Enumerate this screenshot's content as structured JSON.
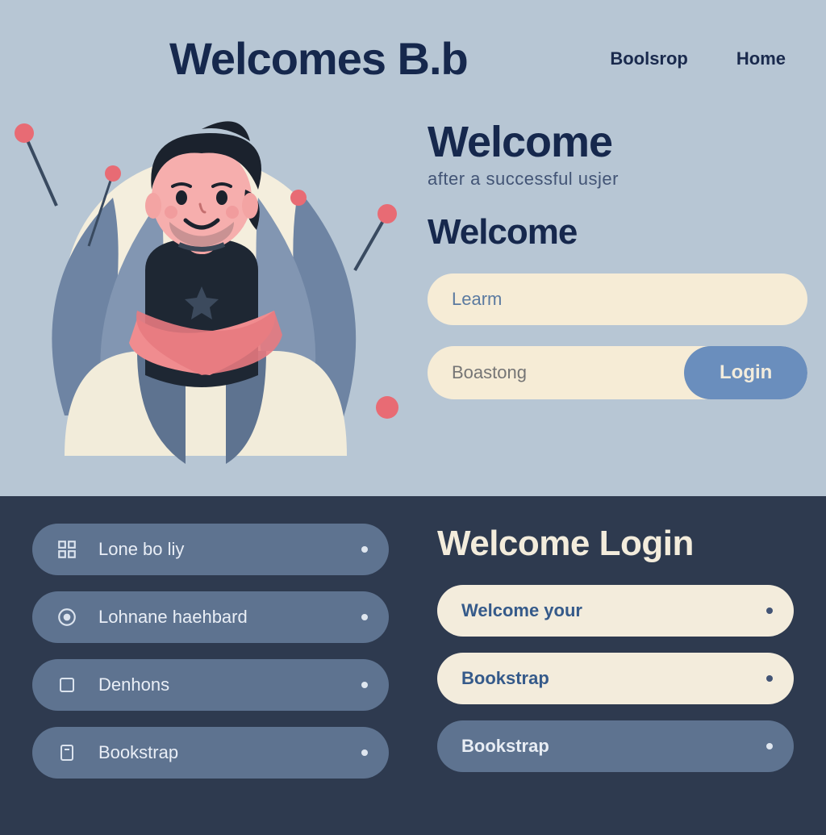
{
  "header": {
    "logo": "Welcomes B.b",
    "nav": [
      {
        "label": "Boolsrop"
      },
      {
        "label": "Home"
      }
    ]
  },
  "hero": {
    "title": "Welcome",
    "subtitle": "after a successful usjer",
    "title2": "Welcome",
    "input1_placeholder": "Learm",
    "input2_placeholder": "Boastong",
    "login_label": "Login"
  },
  "band": {
    "left_items": [
      {
        "label": "Lone bo liy"
      },
      {
        "label": "Lohnane haehbard"
      },
      {
        "label": "Denhons"
      },
      {
        "label": "Bookstrap"
      }
    ],
    "right_title": "Welcome Login",
    "right_items": [
      {
        "label": "Welcome your",
        "style": "light"
      },
      {
        "label": "Bookstrap",
        "style": "light"
      },
      {
        "label": "Bookstrap",
        "style": "gray"
      }
    ]
  }
}
